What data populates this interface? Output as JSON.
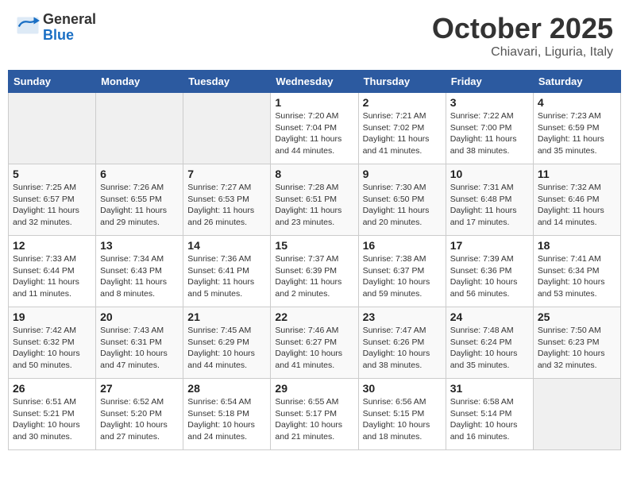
{
  "header": {
    "logo_general": "General",
    "logo_blue": "Blue",
    "month_title": "October 2025",
    "location": "Chiavari, Liguria, Italy"
  },
  "days_of_week": [
    "Sunday",
    "Monday",
    "Tuesday",
    "Wednesday",
    "Thursday",
    "Friday",
    "Saturday"
  ],
  "weeks": [
    [
      {
        "day": "",
        "info": ""
      },
      {
        "day": "",
        "info": ""
      },
      {
        "day": "",
        "info": ""
      },
      {
        "day": "1",
        "info": "Sunrise: 7:20 AM\nSunset: 7:04 PM\nDaylight: 11 hours and 44 minutes."
      },
      {
        "day": "2",
        "info": "Sunrise: 7:21 AM\nSunset: 7:02 PM\nDaylight: 11 hours and 41 minutes."
      },
      {
        "day": "3",
        "info": "Sunrise: 7:22 AM\nSunset: 7:00 PM\nDaylight: 11 hours and 38 minutes."
      },
      {
        "day": "4",
        "info": "Sunrise: 7:23 AM\nSunset: 6:59 PM\nDaylight: 11 hours and 35 minutes."
      }
    ],
    [
      {
        "day": "5",
        "info": "Sunrise: 7:25 AM\nSunset: 6:57 PM\nDaylight: 11 hours and 32 minutes."
      },
      {
        "day": "6",
        "info": "Sunrise: 7:26 AM\nSunset: 6:55 PM\nDaylight: 11 hours and 29 minutes."
      },
      {
        "day": "7",
        "info": "Sunrise: 7:27 AM\nSunset: 6:53 PM\nDaylight: 11 hours and 26 minutes."
      },
      {
        "day": "8",
        "info": "Sunrise: 7:28 AM\nSunset: 6:51 PM\nDaylight: 11 hours and 23 minutes."
      },
      {
        "day": "9",
        "info": "Sunrise: 7:30 AM\nSunset: 6:50 PM\nDaylight: 11 hours and 20 minutes."
      },
      {
        "day": "10",
        "info": "Sunrise: 7:31 AM\nSunset: 6:48 PM\nDaylight: 11 hours and 17 minutes."
      },
      {
        "day": "11",
        "info": "Sunrise: 7:32 AM\nSunset: 6:46 PM\nDaylight: 11 hours and 14 minutes."
      }
    ],
    [
      {
        "day": "12",
        "info": "Sunrise: 7:33 AM\nSunset: 6:44 PM\nDaylight: 11 hours and 11 minutes."
      },
      {
        "day": "13",
        "info": "Sunrise: 7:34 AM\nSunset: 6:43 PM\nDaylight: 11 hours and 8 minutes."
      },
      {
        "day": "14",
        "info": "Sunrise: 7:36 AM\nSunset: 6:41 PM\nDaylight: 11 hours and 5 minutes."
      },
      {
        "day": "15",
        "info": "Sunrise: 7:37 AM\nSunset: 6:39 PM\nDaylight: 11 hours and 2 minutes."
      },
      {
        "day": "16",
        "info": "Sunrise: 7:38 AM\nSunset: 6:37 PM\nDaylight: 10 hours and 59 minutes."
      },
      {
        "day": "17",
        "info": "Sunrise: 7:39 AM\nSunset: 6:36 PM\nDaylight: 10 hours and 56 minutes."
      },
      {
        "day": "18",
        "info": "Sunrise: 7:41 AM\nSunset: 6:34 PM\nDaylight: 10 hours and 53 minutes."
      }
    ],
    [
      {
        "day": "19",
        "info": "Sunrise: 7:42 AM\nSunset: 6:32 PM\nDaylight: 10 hours and 50 minutes."
      },
      {
        "day": "20",
        "info": "Sunrise: 7:43 AM\nSunset: 6:31 PM\nDaylight: 10 hours and 47 minutes."
      },
      {
        "day": "21",
        "info": "Sunrise: 7:45 AM\nSunset: 6:29 PM\nDaylight: 10 hours and 44 minutes."
      },
      {
        "day": "22",
        "info": "Sunrise: 7:46 AM\nSunset: 6:27 PM\nDaylight: 10 hours and 41 minutes."
      },
      {
        "day": "23",
        "info": "Sunrise: 7:47 AM\nSunset: 6:26 PM\nDaylight: 10 hours and 38 minutes."
      },
      {
        "day": "24",
        "info": "Sunrise: 7:48 AM\nSunset: 6:24 PM\nDaylight: 10 hours and 35 minutes."
      },
      {
        "day": "25",
        "info": "Sunrise: 7:50 AM\nSunset: 6:23 PM\nDaylight: 10 hours and 32 minutes."
      }
    ],
    [
      {
        "day": "26",
        "info": "Sunrise: 6:51 AM\nSunset: 5:21 PM\nDaylight: 10 hours and 30 minutes."
      },
      {
        "day": "27",
        "info": "Sunrise: 6:52 AM\nSunset: 5:20 PM\nDaylight: 10 hours and 27 minutes."
      },
      {
        "day": "28",
        "info": "Sunrise: 6:54 AM\nSunset: 5:18 PM\nDaylight: 10 hours and 24 minutes."
      },
      {
        "day": "29",
        "info": "Sunrise: 6:55 AM\nSunset: 5:17 PM\nDaylight: 10 hours and 21 minutes."
      },
      {
        "day": "30",
        "info": "Sunrise: 6:56 AM\nSunset: 5:15 PM\nDaylight: 10 hours and 18 minutes."
      },
      {
        "day": "31",
        "info": "Sunrise: 6:58 AM\nSunset: 5:14 PM\nDaylight: 10 hours and 16 minutes."
      },
      {
        "day": "",
        "info": ""
      }
    ]
  ]
}
